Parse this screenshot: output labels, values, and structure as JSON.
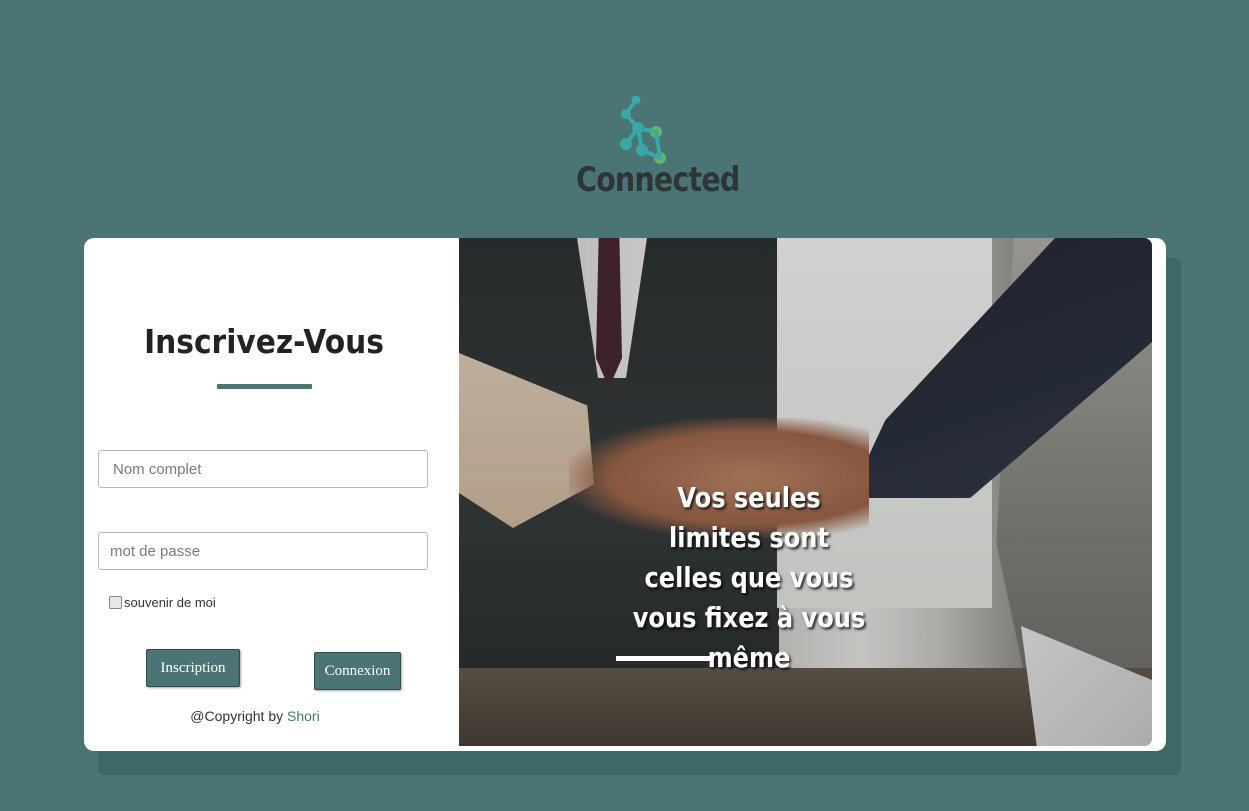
{
  "brand": {
    "name": "Connected",
    "colors": {
      "teal": "#4a7574",
      "dots": [
        "#3aa8a8",
        "#62b56a"
      ]
    }
  },
  "form": {
    "title": "Inscrivez-Vous",
    "name_placeholder": "Nom complet",
    "password_placeholder": "mot de passe",
    "remember_label": "souvenir de moi",
    "signup_label": "Inscription",
    "login_label": "Connexion",
    "copyright_prefix": "@Copyright by",
    "copyright_author": "Shori"
  },
  "hero": {
    "quote": "Vos seules limites sont celles que vous vous fixez à vous même"
  }
}
